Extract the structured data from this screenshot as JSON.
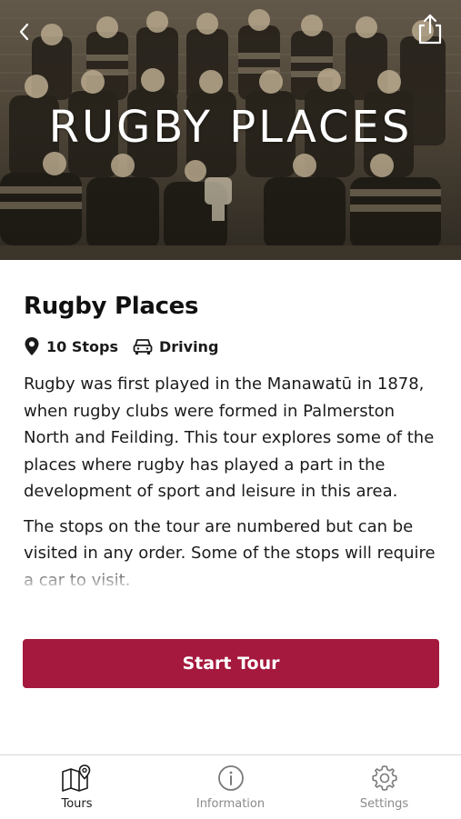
{
  "hero": {
    "title": "RUGBY PLACES",
    "back_icon": "chevron-left-icon",
    "share_icon": "share-icon"
  },
  "tour": {
    "title": "Rugby Places",
    "stops": "10 Stops",
    "transport": "Driving",
    "description": [
      "Rugby was first played in the Manawatū in 1878, when rugby clubs were formed in Palmerston North and Feilding. This tour explores some of the places where rugby has played a part in the development of sport and leisure in this area.",
      "The stops on the tour are numbered but can be visited in any order. Some of the stops will require a car to visit."
    ],
    "start_label": "Start Tour"
  },
  "tabs": [
    {
      "label": "Tours",
      "icon": "map-pin-icon",
      "active": true
    },
    {
      "label": "Information",
      "icon": "info-icon",
      "active": false
    },
    {
      "label": "Settings",
      "icon": "gear-icon",
      "active": false
    }
  ],
  "colors": {
    "accent": "#a4193d",
    "hero_tint": "#4a4236"
  }
}
